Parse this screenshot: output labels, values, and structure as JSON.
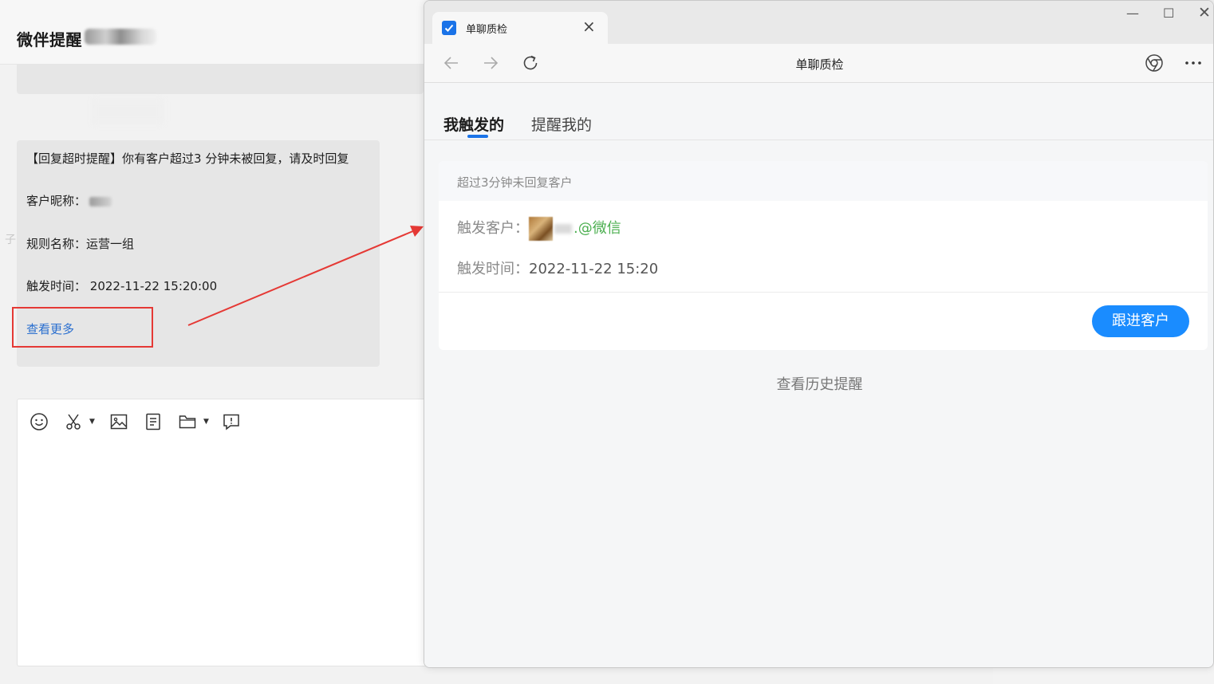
{
  "chat": {
    "title": "微伴提醒",
    "message": {
      "line1": "【回复超时提醒】你有客户超过3 分钟未被回复，请及时回复",
      "nickname_label": "客户昵称：",
      "rule_label": "规则名称：",
      "rule_value": "运营一组",
      "time_label": "触发时间：",
      "time_value": "2022-11-22 15:20:00",
      "view_more": "查看更多"
    },
    "toolbar": [
      "emoji-icon",
      "scissors-icon",
      "image-icon",
      "document-icon",
      "folder-icon",
      "chat-bubble-icon"
    ]
  },
  "browser": {
    "tab_title": "单聊质检",
    "page_title": "单聊质检",
    "tabs": [
      {
        "label": "我触发的",
        "active": true
      },
      {
        "label": "提醒我的",
        "active": false
      }
    ],
    "card": {
      "header": "超过3分钟未回复客户",
      "customer_label": "触发客户：",
      "customer_suffix": ".@微信",
      "time_label": "触发时间：",
      "time_value": "2022-11-22 15:20",
      "follow_button": "跟进客户"
    },
    "history_link": "查看历史提醒"
  },
  "colors": {
    "accent": "#1a8cff",
    "link": "#2a6fcf",
    "wechat_green": "#4caf50",
    "annotation_red": "#e53935"
  }
}
